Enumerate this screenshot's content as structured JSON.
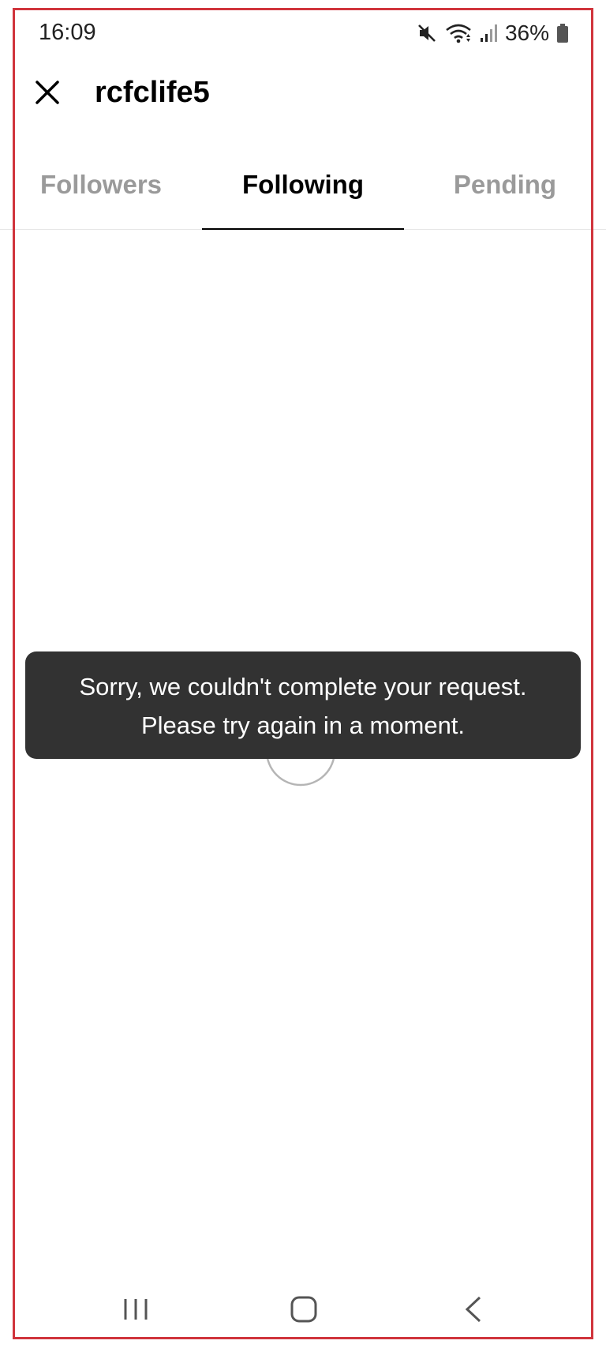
{
  "status_bar": {
    "time": "16:09",
    "battery_percent": "36%",
    "icons": [
      "mute-icon",
      "wifi-icon",
      "signal-icon",
      "battery-icon"
    ]
  },
  "header": {
    "username": "rcfclife5",
    "close_icon": "close-icon"
  },
  "tabs": [
    {
      "label": "Followers",
      "active": false
    },
    {
      "label": "Following",
      "active": true
    },
    {
      "label": "Pending",
      "active": false
    }
  ],
  "toast": {
    "line1": "Sorry, we couldn't complete your request.",
    "line2": "Please try again in a moment."
  },
  "nav_bar": {
    "icons": [
      "recents-icon",
      "home-icon",
      "back-icon"
    ]
  },
  "colors": {
    "active_tab": "#000000",
    "inactive_tab": "#9a9a9a",
    "toast_bg": "#323232",
    "frame_border": "#d0343c"
  }
}
